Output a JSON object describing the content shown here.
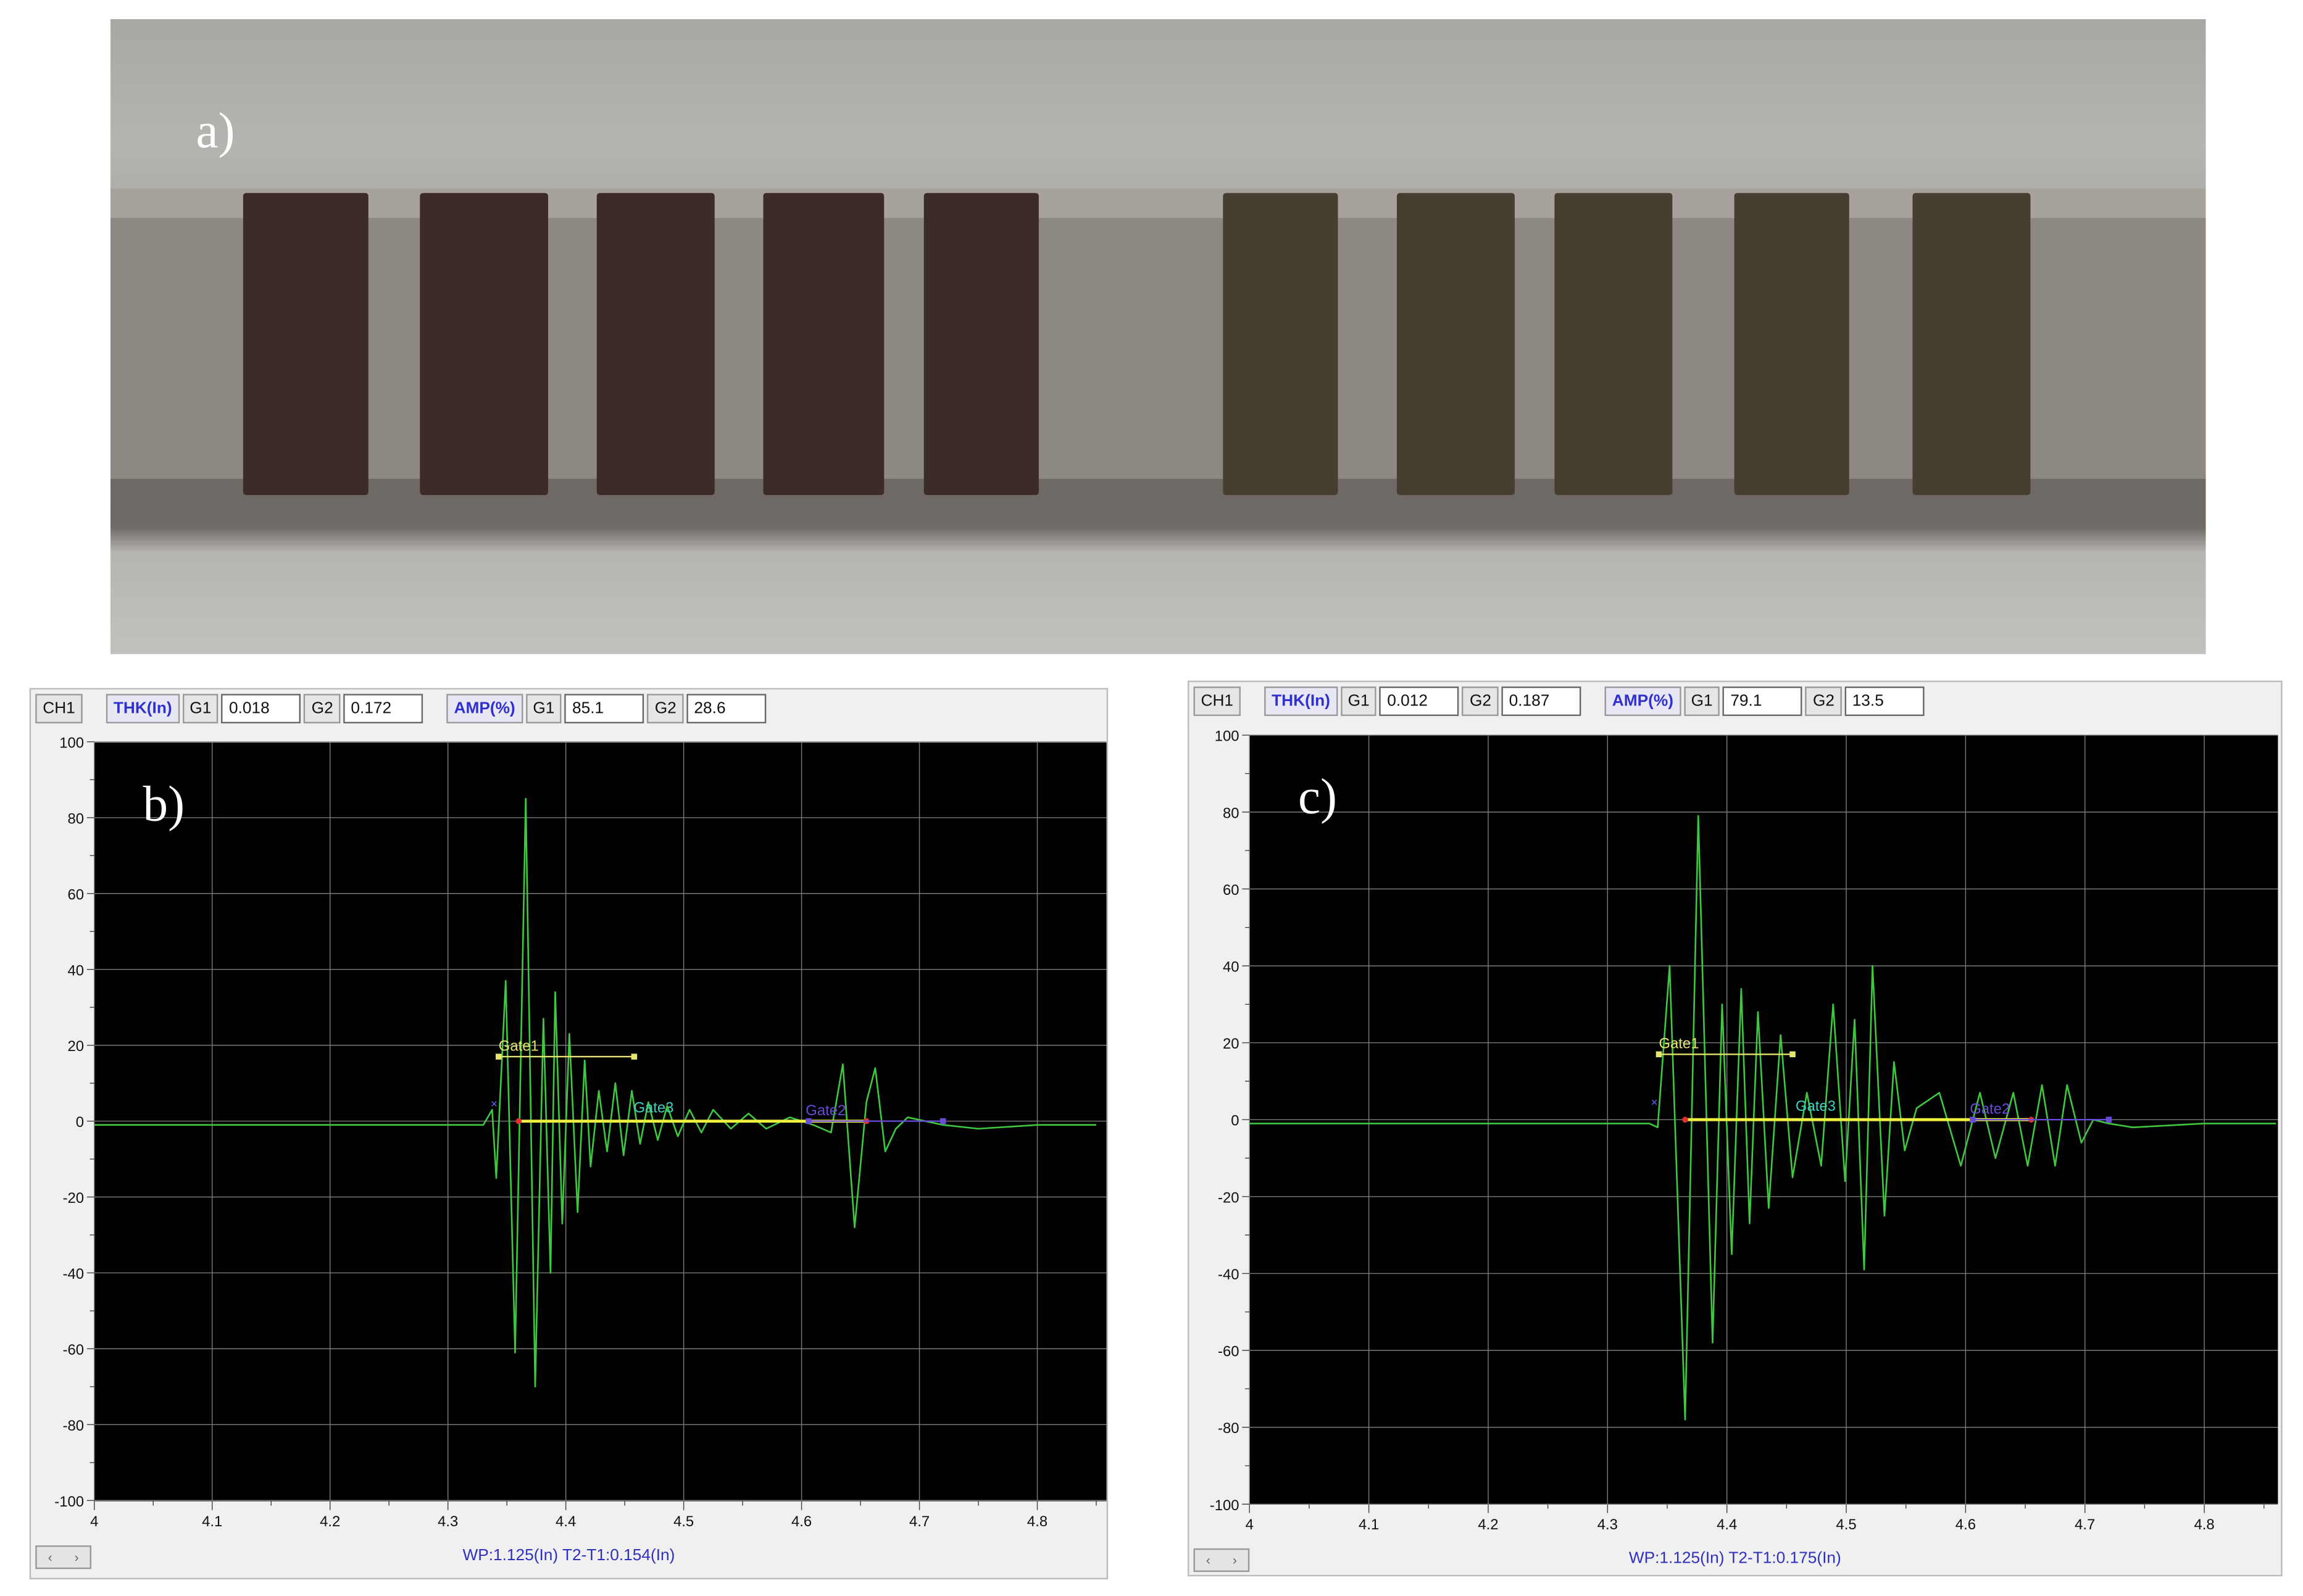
{
  "labels": {
    "a": "a)",
    "b": "b)",
    "c": "c)"
  },
  "panels": [
    {
      "channel": "CH1",
      "thk_label": "THK(In)",
      "thk_g1_label": "G1",
      "thk_g1": "0.018",
      "thk_g2_label": "G2",
      "thk_g2": "0.172",
      "amp_label": "AMP(%)",
      "amp_g1_label": "G1",
      "amp_g1": "85.1",
      "amp_g2_label": "G2",
      "amp_g2": "28.6",
      "status": "WP:1.125(In)  T2-T1:0.154(In)",
      "scroll_left": "‹",
      "scroll_right": "›"
    },
    {
      "channel": "CH1",
      "thk_label": "THK(In)",
      "thk_g1_label": "G1",
      "thk_g1": "0.012",
      "thk_g2_label": "G2",
      "thk_g2": "0.187",
      "amp_label": "AMP(%)",
      "amp_g1_label": "G1",
      "amp_g1": "79.1",
      "amp_g2_label": "G2",
      "amp_g2": "13.5",
      "status": "WP:1.125(In)  T2-T1:0.175(In)",
      "scroll_left": "‹",
      "scroll_right": "›"
    }
  ],
  "colors": {
    "signal": "#3fc83f",
    "gate1": "#e6e66e",
    "gate2": "#6a4ad8",
    "gate3": "#40d0c0",
    "gateline": "#f0f040",
    "marker": "#e03030",
    "grid": "#7a7a7a",
    "block_dark": "#3d2b27",
    "block_olive": "#463f31"
  },
  "chart_data": [
    {
      "type": "line",
      "title": "",
      "xlabel": "",
      "ylabel": "",
      "xlim": [
        4,
        4.85
      ],
      "ylim": [
        -100,
        100
      ],
      "grid": true,
      "xticks": [
        "4",
        "4.1",
        "4.2",
        "4.3",
        "4.4",
        "4.5",
        "4.6",
        "4.7",
        "4.8"
      ],
      "yticks": [
        "100",
        "80",
        "60",
        "40",
        "20",
        "0",
        "-20",
        "-40",
        "-60",
        "-80",
        "-100"
      ],
      "gates": [
        {
          "name": "Gate1",
          "x": [
            4.343,
            4.458
          ],
          "y": 17
        },
        {
          "name": "Gate3",
          "x": [
            4.46,
            4.47
          ],
          "y": 0
        },
        {
          "name": "Gate2",
          "x": [
            4.606,
            4.72
          ],
          "y": 0
        }
      ],
      "gate_line": {
        "x": [
          4.36,
          4.655
        ],
        "y": 0
      },
      "series": [
        {
          "name": "A-scan",
          "x": [
            4,
            4.1,
            4.2,
            4.3,
            4.33,
            4.3375,
            4.341,
            4.349,
            4.357,
            4.366,
            4.374,
            4.381,
            4.387,
            4.391,
            4.397,
            4.403,
            4.41,
            4.416,
            4.421,
            4.428,
            4.435,
            4.442,
            4.449,
            4.456,
            4.463,
            4.47,
            4.478,
            4.486,
            4.495,
            4.505,
            4.515,
            4.525,
            4.54,
            4.555,
            4.57,
            4.59,
            4.61,
            4.625,
            4.635,
            4.645,
            4.655,
            4.6625,
            4.671,
            4.68,
            4.69,
            4.72,
            4.75,
            4.8,
            4.85
          ],
          "y": [
            -1,
            -1,
            -1,
            -1,
            -1,
            3,
            -15,
            37,
            -61,
            85,
            -70,
            27,
            -40,
            34,
            -27,
            23,
            -24,
            16,
            -12,
            8,
            -8,
            10,
            -9,
            8,
            -6,
            5,
            -5,
            4,
            -4,
            3,
            -3,
            3,
            -2,
            2,
            -2,
            1,
            -1,
            -3,
            15,
            -28,
            5,
            14,
            -8,
            -2,
            1,
            -1,
            -2,
            -1,
            -1
          ]
        }
      ]
    },
    {
      "type": "line",
      "title": "",
      "xlabel": "",
      "ylabel": "",
      "xlim": [
        4,
        4.86
      ],
      "ylim": [
        -100,
        100
      ],
      "grid": true,
      "xticks": [
        "4",
        "4.1",
        "4.2",
        "4.3",
        "4.4",
        "4.5",
        "4.6",
        "4.7",
        "4.8"
      ],
      "yticks": [
        "100",
        "80",
        "60",
        "40",
        "20",
        "0",
        "-20",
        "-40",
        "-60",
        "-80",
        "-100"
      ],
      "gates": [
        {
          "name": "Gate1",
          "x": [
            4.343,
            4.455
          ],
          "y": 17
        },
        {
          "name": "Gate3",
          "x": [
            4.46,
            4.47
          ],
          "y": 0
        },
        {
          "name": "Gate2",
          "x": [
            4.606,
            4.72
          ],
          "y": 0
        }
      ],
      "gate_line": {
        "x": [
          4.365,
          4.655
        ],
        "y": 0
      },
      "series": [
        {
          "name": "A-scan",
          "x": [
            4,
            4.1,
            4.2,
            4.3,
            4.335,
            4.342,
            4.352,
            4.365,
            4.376,
            4.388,
            4.396,
            4.404,
            4.412,
            4.419,
            4.426,
            4.435,
            4.445,
            4.455,
            4.467,
            4.479,
            4.489,
            4.499,
            4.507,
            4.515,
            4.522,
            4.532,
            4.54,
            4.549,
            4.559,
            4.578,
            4.596,
            4.612,
            4.625,
            4.64,
            4.652,
            4.664,
            4.675,
            4.685,
            4.697,
            4.707,
            4.72,
            4.74,
            4.8,
            4.86
          ],
          "y": [
            -1,
            -1,
            -1,
            -1,
            -1,
            -2,
            40,
            -78,
            79,
            -58,
            30,
            -35,
            34,
            -27,
            28,
            -23,
            22,
            -15,
            7,
            -12,
            30,
            -16,
            26,
            -39,
            40,
            -25,
            15,
            -8,
            3,
            7,
            -12,
            7,
            -10,
            7,
            -12,
            9,
            -12,
            9,
            -6,
            0,
            -1,
            -2,
            -1,
            -1
          ]
        }
      ]
    }
  ]
}
